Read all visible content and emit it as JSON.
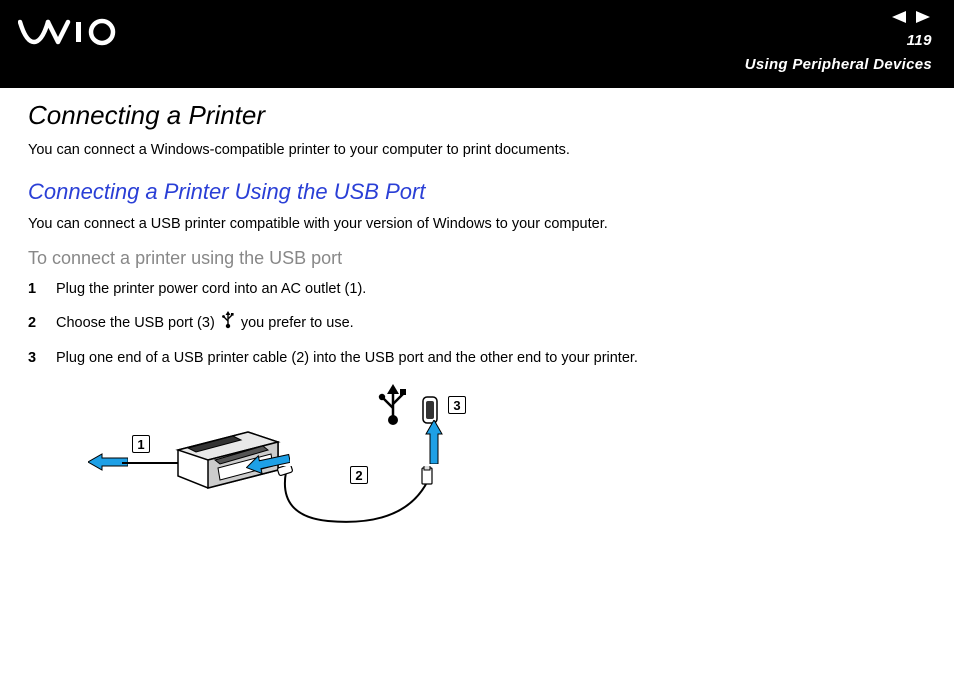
{
  "header": {
    "page_number": "119",
    "section_name": "Using Peripheral Devices"
  },
  "content": {
    "main_heading": "Connecting a Printer",
    "intro": "You can connect a Windows-compatible printer to your computer to print documents.",
    "sub_heading": "Connecting a Printer Using the USB Port",
    "sub_intro": "You can connect a USB printer compatible with your version of Windows to your computer.",
    "procedure_heading": "To connect a printer using the USB port",
    "steps": [
      {
        "num": "1",
        "text": "Plug the printer power cord into an AC outlet (1)."
      },
      {
        "num": "2",
        "text_before": "Choose the USB port (3) ",
        "text_after": " you prefer to use."
      },
      {
        "num": "3",
        "text": "Plug one end of a USB printer cable (2) into the USB port and the other end to your printer."
      }
    ],
    "callouts": {
      "c1": "1",
      "c2": "2",
      "c3": "3"
    }
  }
}
